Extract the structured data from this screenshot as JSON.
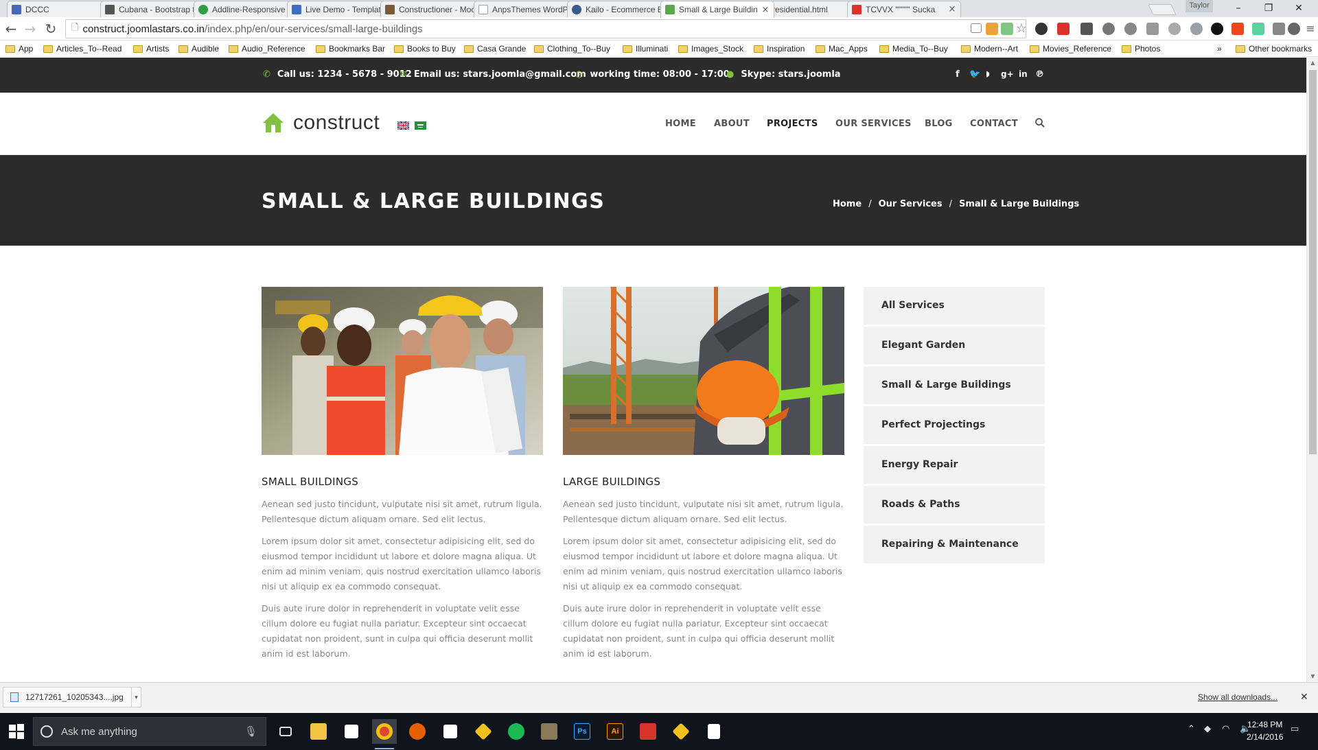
{
  "browser": {
    "tabs": [
      {
        "title": "DCCC",
        "color": "#4a68b8"
      },
      {
        "title": "Cubana - Bootstrap t",
        "color": "#555555"
      },
      {
        "title": "Addline-Responsive c",
        "color": "#2f9e44"
      },
      {
        "title": "Live Demo - Templat",
        "color": "#3f6fc4"
      },
      {
        "title": "Constructioner - Moc",
        "color": "#7a5a3a"
      },
      {
        "title": "AnpsThemes WordPr",
        "color": "#9aa0a6"
      },
      {
        "title": "Kailo - Ecommerce B",
        "color": "#3b5b8e"
      },
      {
        "title": "Small & Large Buildin",
        "color": "#5aa84a"
      },
      {
        "title": "residential.html",
        "color": "#9aa0a6"
      },
      {
        "title": "TCVVX \"\"\"\"\" Sucka",
        "color": "#d9342b"
      }
    ],
    "profile_name": "Taylor",
    "url_host": "construct.joomlastars.co.in",
    "url_path": "/index.php/en/our-services/small-large-buildings",
    "bookmarks": [
      "App",
      "Articles_To--Read",
      "Artists",
      "Audible",
      "Audio_Reference",
      "Bookmarks Bar",
      "Books to Buy",
      "Casa Grande",
      "Clothing_To--Buy",
      "Illuminati",
      "Images_Stock",
      "Inspiration",
      "Mac_Apps",
      "Media_To--Buy",
      "Modern--Art",
      "Movies_Reference",
      "Photos"
    ],
    "bookmarks_overflow": "»",
    "other_bookmarks": "Other bookmarks"
  },
  "topbar": {
    "phone": "Call us: 1234 - 5678 - 9012",
    "email": "Email us: stars.joomla@gmail.com",
    "hours": "working time: 08:00 - 17:00",
    "skype": "Skype: stars.joomla",
    "social": [
      "f",
      "t",
      "rss",
      "g+",
      "in",
      "p"
    ]
  },
  "header": {
    "logo_text": "construct",
    "nav": [
      "HOME",
      "ABOUT",
      "PROJECTS",
      "OUR SERVICES",
      "BLOG",
      "CONTACT"
    ],
    "active_nav": "PROJECTS"
  },
  "title_area": {
    "title": "SMALL & LARGE BUILDINGS",
    "breadcrumb": [
      "Home",
      "Our Services",
      "Small & Large Buildings"
    ],
    "separator": "/"
  },
  "content": {
    "columns": [
      {
        "heading": "SMALL BUILDINGS",
        "paragraphs": [
          "Aenean sed justo tincidunt, vulputate nisi sit amet, rutrum ligula. Pellentesque dictum aliquam ornare. Sed elit lectus.",
          "Lorem ipsum dolor sit amet, consectetur adipisicing elit, sed do eiusmod tempor incididunt ut labore et dolore magna aliqua. Ut enim ad minim veniam, quis nostrud exercitation ullamco laboris nisi ut aliquip ex ea commodo consequat.",
          "Duis aute irure dolor in reprehenderit in voluptate velit esse cillum dolore eu fugiat nulla pariatur. Excepteur sint occaecat cupidatat non proident, sunt in culpa qui officia deserunt mollit anim id est laborum."
        ]
      },
      {
        "heading": "LARGE BUILDINGS",
        "paragraphs": [
          "Aenean sed justo tincidunt, vulputate nisi sit amet, rutrum ligula. Pellentesque dictum aliquam ornare. Sed elit lectus.",
          "Lorem ipsum dolor sit amet, consectetur adipisicing elit, sed do eiusmod tempor incididunt ut labore et dolore magna aliqua. Ut enim ad minim veniam, quis nostrud exercitation ullamco laboris nisi ut aliquip ex ea commodo consequat.",
          "Duis aute irure dolor in reprehenderit in voluptate velit esse cillum dolore eu fugiat nulla pariatur. Excepteur sint occaecat cupidatat non proident, sunt in culpa qui officia deserunt mollit anim id est laborum."
        ]
      }
    ],
    "sidebar": [
      "All Services",
      "Elegant Garden",
      "Small & Large Buildings",
      "Perfect Projectings",
      "Energy Repair",
      "Roads & Paths",
      "Repairing & Maintenance"
    ]
  },
  "downloads": {
    "file": "12717261_10205343....jpg",
    "show_all": "Show all downloads..."
  },
  "taskbar": {
    "search_placeholder": "Ask me anything",
    "time": "12:48 PM",
    "date": "2/14/2016"
  },
  "colors": {
    "accent_green": "#80c13d",
    "dark_bar": "#2b2b2b",
    "sidebar_bg": "#f2f2f2"
  }
}
